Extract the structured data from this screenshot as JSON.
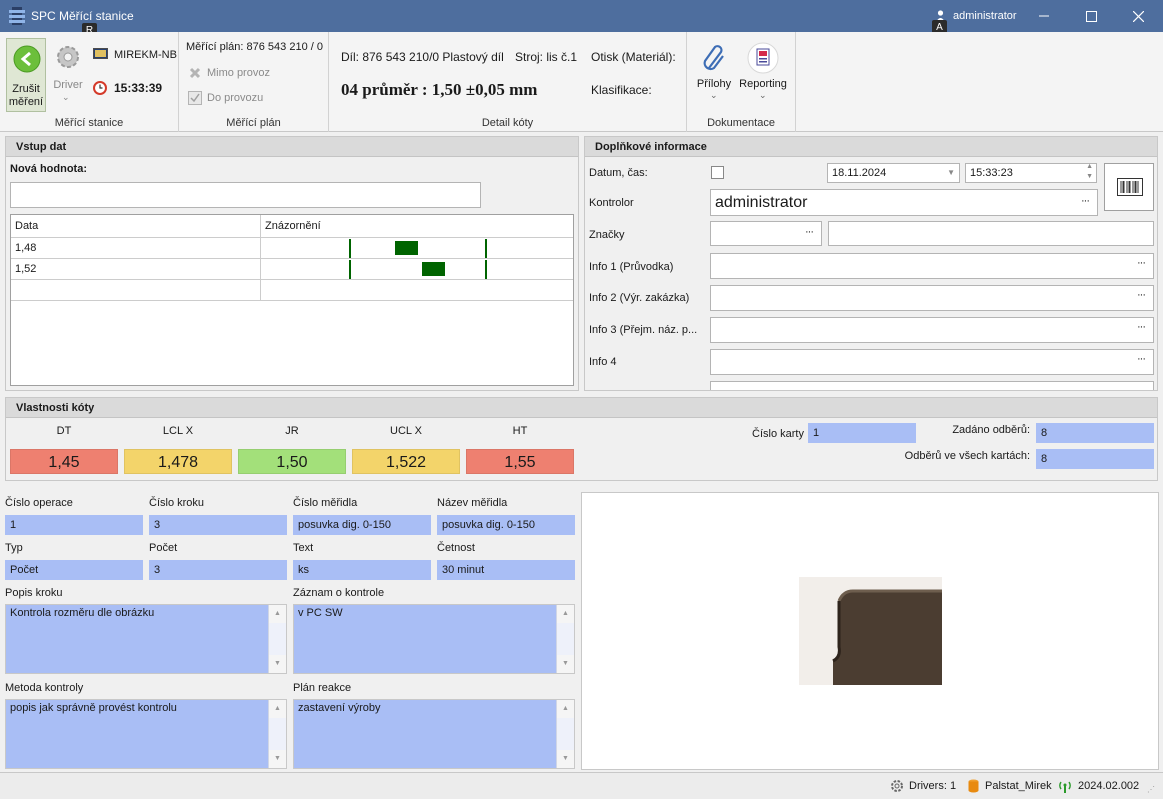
{
  "window": {
    "title": "SPC Měřící stanice",
    "user": "administrator",
    "keytip_r": "R",
    "keytip_a": "A"
  },
  "ribbon": {
    "station": {
      "cancel_label": "Zrušit měření",
      "driver_label": "Driver",
      "computer": "MIREKM-NB",
      "time": "15:33:39",
      "group_label": "Měřící stanice"
    },
    "plan": {
      "plan_label": "Měřící plán: 876 543 210 / 0",
      "out_of_service": "Mimo provoz",
      "into_service": "Do provozu",
      "group_label": "Měřící plán"
    },
    "detail": {
      "part": "Díl: 876 543 210/0 Plastový díl",
      "machine": "Stroj: lis č.1",
      "mold": "Otisk (Materiál):",
      "dimension": "04 průměr : 1,50 ±0,05 mm",
      "classification": "Klasifikace:",
      "group_label": "Detail kóty"
    },
    "docs": {
      "attachments": "Přílohy",
      "reporting": "Reporting",
      "group_label": "Dokumentace"
    }
  },
  "input": {
    "title": "Vstup dat",
    "new_value_label": "Nová hodnota:",
    "new_value": "",
    "columns": [
      "Data",
      "Znázornění"
    ],
    "rows": [
      {
        "value": "1,48",
        "bar_from": 1.48,
        "bar_to": 1.5
      },
      {
        "value": "1,52",
        "bar_from": 1.5,
        "bar_to": 1.52
      }
    ]
  },
  "additional": {
    "title": "Doplňkové informace",
    "datetime_label": "Datum, čas:",
    "date": "18.11.2024",
    "time": "15:33:23",
    "inspector_label": "Kontrolor",
    "inspector": "administrator",
    "tags_label": "Značky",
    "info1_label": "Info 1 (Průvodka)",
    "info2_label": "Info 2 (Výr. zakázka)",
    "info3_label": "Info 3 (Přejm. náz. p...",
    "info4_label": "Info 4",
    "ellipsis": "···"
  },
  "props": {
    "title": "Vlastnosti kóty",
    "limits": [
      {
        "label": "DT",
        "value": "1,45",
        "color": "#ee8070"
      },
      {
        "label": "LCL X",
        "value": "1,478",
        "color": "#f3d46a"
      },
      {
        "label": "JR",
        "value": "1,50",
        "color": "#a3e07a"
      },
      {
        "label": "UCL X",
        "value": "1,522",
        "color": "#f3d46a"
      },
      {
        "label": "HT",
        "value": "1,55",
        "color": "#ee8070"
      }
    ],
    "card_no_label": "Číslo karty",
    "card_no": "1",
    "samples_entered_label": "Zadáno odběrů:",
    "samples_entered": "8",
    "samples_all_label": "Odběrů ve všech kartách:",
    "samples_all": "8"
  },
  "details": {
    "op_no_label": "Číslo operace",
    "op_no": "1",
    "step_no_label": "Číslo kroku",
    "step_no": "3",
    "gauge_no_label": "Číslo měřidla",
    "gauge_no": "posuvka dig. 0-150",
    "gauge_name_label": "Název měřidla",
    "gauge_name": "posuvka dig. 0-150",
    "type_label": "Typ",
    "type": "Počet",
    "count_label": "Počet",
    "count": "3",
    "text_label": "Text",
    "text": "ks",
    "freq_label": "Četnost",
    "freq": "30 minut",
    "step_desc_label": "Popis kroku",
    "step_desc": "Kontrola rozměru dle obrázku",
    "record_label": "Záznam o kontrole",
    "record": "v PC SW",
    "method_label": "Metoda kontroly",
    "method": "popis jak správně provést kontrolu",
    "reaction_label": "Plán reakce",
    "reaction": "zastavení výroby"
  },
  "status": {
    "drivers": "Drivers: 1",
    "db": "Palstat_Mirek",
    "version": "2024.02.002"
  },
  "colors": {
    "titlebar": "#4e6e9e",
    "field_blue": "#a9bef5",
    "bar_green": "#006400"
  },
  "icons": [
    "back-arrow-icon",
    "gear-icon",
    "monitor-icon",
    "clock-icon",
    "cross-icon",
    "check-icon",
    "paperclip-icon",
    "report-icon",
    "barcode-icon",
    "user-icon",
    "database-icon",
    "signal-icon"
  ]
}
